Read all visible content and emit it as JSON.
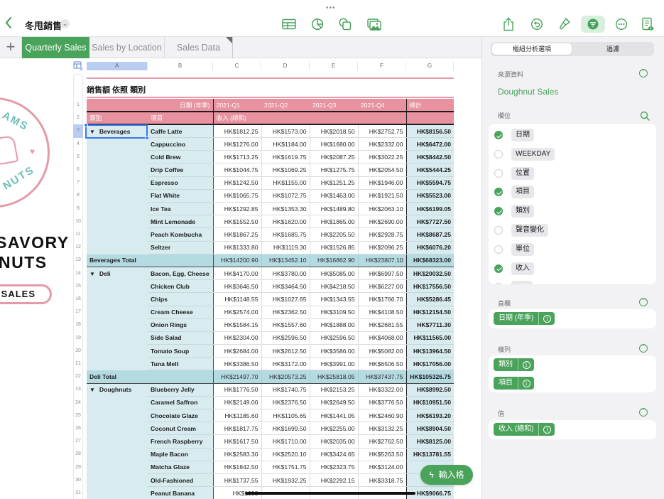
{
  "toolbar": {
    "grabber": "•••",
    "back_icon": "chevron-left-icon",
    "doc_title": "冬甩銷售",
    "title_menu_icon": "chevron-down-icon",
    "icons_center": [
      "table-icon",
      "chart-icon",
      "shapes-icon",
      "media-icon"
    ],
    "icons_right": [
      "share-icon",
      "undo-icon",
      "format-brush-icon",
      "organize-icon",
      "more-icon",
      "reading-view-icon"
    ],
    "accent_color": "#49a35a"
  },
  "sheet_tabs": {
    "add_label": "+",
    "tabs": [
      {
        "label": "Quarterly Sales",
        "active": true
      },
      {
        "label": "Sales by Location",
        "active": false
      },
      {
        "label": "Sales Data",
        "active": false
      }
    ]
  },
  "canvas": {
    "logo_top_text": "AMS",
    "logo_bottom_text": "NUTS",
    "headline_line1": "SAVORY",
    "headline_line2": "NUTS",
    "button_label": "T SALES"
  },
  "spreadsheet": {
    "column_letters": [
      "A",
      "B",
      "C",
      "D",
      "E",
      "F",
      "G"
    ],
    "selected_column": "A",
    "selected_row": 3,
    "row_numbers": [
      1,
      2,
      3,
      4,
      5,
      6,
      7,
      8,
      9,
      10,
      11,
      12,
      13,
      14,
      15,
      16,
      17,
      18,
      19,
      20,
      21,
      22,
      23,
      24,
      25,
      26,
      27,
      28,
      29,
      30,
      31
    ],
    "table_title": "銷售額 依照 類別",
    "header_row1": {
      "column_field": "日期 (年季)",
      "quarters": [
        "2021-Q1",
        "2021-Q2",
        "2021-Q3",
        "2021-Q4"
      ],
      "total_label": "總計"
    },
    "header_row2": {
      "category_label": "類別",
      "item_label": "項目",
      "value_label": "收入 (總和)"
    },
    "groups": [
      {
        "category": "Beverages",
        "rows": [
          {
            "item": "Caffe Latte",
            "q": [
              "HK$1812.25",
              "HK$1573.00",
              "HK$2018.50",
              "HK$2752.75"
            ],
            "total": "HK$8156.50"
          },
          {
            "item": "Cappuccino",
            "q": [
              "HK$1276.00",
              "HK$1184.00",
              "HK$1680.00",
              "HK$2332.00"
            ],
            "total": "HK$6472.00"
          },
          {
            "item": "Cold Brew",
            "q": [
              "HK$1713.25",
              "HK$1619.75",
              "HK$2087.25",
              "HK$3022.25"
            ],
            "total": "HK$8442.50"
          },
          {
            "item": "Drip Coffee",
            "q": [
              "HK$1044.75",
              "HK$1069.25",
              "HK$1275.75",
              "HK$2054.50"
            ],
            "total": "HK$5444.25"
          },
          {
            "item": "Espresso",
            "q": [
              "HK$1242.50",
              "HK$1155.00",
              "HK$1251.25",
              "HK$1946.00"
            ],
            "total": "HK$5594.75"
          },
          {
            "item": "Flat White",
            "q": [
              "HK$1065.75",
              "HK$1072.75",
              "HK$1463.00",
              "HK$1921.50"
            ],
            "total": "HK$5523.00"
          },
          {
            "item": "Ice Tea",
            "q": [
              "HK$1292.85",
              "HK$1353.30",
              "HK$1489.80",
              "HK$2063.10"
            ],
            "total": "HK$6199.05"
          },
          {
            "item": "Mint Lemonade",
            "q": [
              "HK$1552.50",
              "HK$1620.00",
              "HK$1865.00",
              "HK$2690.00"
            ],
            "total": "HK$7727.50"
          },
          {
            "item": "Peach Kombucha",
            "q": [
              "HK$1867.25",
              "HK$1685.75",
              "HK$2205.50",
              "HK$2928.75"
            ],
            "total": "HK$8687.25"
          },
          {
            "item": "Seltzer",
            "q": [
              "HK$1333.80",
              "HK$1119.30",
              "HK$1526.85",
              "HK$2096.25"
            ],
            "total": "HK$6076.20"
          }
        ],
        "subtotal": {
          "label": "Beverages Total",
          "q": [
            "HK$14200.90",
            "HK$13452.10",
            "HK$16862.90",
            "HK$23807.10"
          ],
          "total": "HK$68323.00"
        }
      },
      {
        "category": "Deli",
        "rows": [
          {
            "item": "Bacon, Egg, Cheese",
            "q": [
              "HK$4170.00",
              "HK$3780.00",
              "HK$5085.00",
              "HK$6997.50"
            ],
            "total": "HK$20032.50"
          },
          {
            "item": "Chicken Club",
            "q": [
              "HK$3646.50",
              "HK$3464.50",
              "HK$4218.50",
              "HK$6227.00"
            ],
            "total": "HK$17556.50"
          },
          {
            "item": "Chips",
            "q": [
              "HK$1148.55",
              "HK$1027.65",
              "HK$1343.55",
              "HK$1766.70"
            ],
            "total": "HK$5286.45"
          },
          {
            "item": "Cream Cheese",
            "q": [
              "HK$2574.00",
              "HK$2362.50",
              "HK$3109.50",
              "HK$4108.50"
            ],
            "total": "HK$12154.50"
          },
          {
            "item": "Onion Rings",
            "q": [
              "HK$1584.15",
              "HK$1557.60",
              "HK$1888.00",
              "HK$2681.55"
            ],
            "total": "HK$7711.30"
          },
          {
            "item": "Side Salad",
            "q": [
              "HK$2304.00",
              "HK$2596.50",
              "HK$2596.50",
              "HK$4068.00"
            ],
            "total": "HK$11565.00"
          },
          {
            "item": "Tomato Soup",
            "q": [
              "HK$2684.00",
              "HK$2612.50",
              "HK$3586.00",
              "HK$5082.00"
            ],
            "total": "HK$13964.50"
          },
          {
            "item": "Tuna Melt",
            "q": [
              "HK$3386.50",
              "HK$3172.00",
              "HK$3991.00",
              "HK$6506.50"
            ],
            "total": "HK$17056.00"
          }
        ],
        "subtotal": {
          "label": "Deli Total",
          "q": [
            "HK$21497.70",
            "HK$20573.25",
            "HK$25818.05",
            "HK$37437.75"
          ],
          "total": "HK$105326.75"
        }
      },
      {
        "category": "Doughnuts",
        "rows": [
          {
            "item": "Blueberry Jelly",
            "q": [
              "HK$1776.50",
              "HK$1740.75",
              "HK$2153.25",
              "HK$3322.00"
            ],
            "total": "HK$8992.50"
          },
          {
            "item": "Caramel Saffron",
            "q": [
              "HK$2149.00",
              "HK$2376.50",
              "HK$2649.50",
              "HK$3776.50"
            ],
            "total": "HK$10951.50"
          },
          {
            "item": "Chocolate Glaze",
            "q": [
              "HK$1185.60",
              "HK$1105.65",
              "HK$1441.05",
              "HK$2460.90"
            ],
            "total": "HK$6193.20"
          },
          {
            "item": "Coconut Cream",
            "q": [
              "HK$1817.75",
              "HK$1699.50",
              "HK$2255.00",
              "HK$3132.25"
            ],
            "total": "HK$8904.50"
          },
          {
            "item": "French Raspberry",
            "q": [
              "HK$1617.50",
              "HK$1710.00",
              "HK$2035.00",
              "HK$2762.50"
            ],
            "total": "HK$8125.00"
          },
          {
            "item": "Maple Bacon",
            "q": [
              "HK$2583.30",
              "HK$2520.10",
              "HK$3424.65",
              "HK$5263.50"
            ],
            "total": "HK$13781.55"
          },
          {
            "item": "Matcha Glaze",
            "q": [
              "HK$1842.50",
              "HK$1751.75",
              "HK$2323.75",
              "HK$3124.00"
            ],
            "total": "HK"
          },
          {
            "item": "Old-Fashioned",
            "q": [
              "HK$1737.55",
              "HK$1932.25",
              "HK$2292.15",
              "HK$3318.75"
            ],
            "total": "HK"
          },
          {
            "item": "Peanut Banana",
            "q": [
              "HK$1998",
              "",
              "",
              ""
            ],
            "total": "HK$9066.75"
          }
        ]
      }
    ]
  },
  "fab": {
    "label": "輸入格",
    "icon": "bolt-icon"
  },
  "panel": {
    "segments": [
      {
        "label": "樞紐分析選項",
        "active": true
      },
      {
        "label": "過濾",
        "active": false
      }
    ],
    "source_label": "來源資料",
    "source_value": "Doughnut Sales",
    "fields_label": "欄位",
    "fields": [
      {
        "label": "日期",
        "checked": true
      },
      {
        "label": "WEEKDAY",
        "checked": false
      },
      {
        "label": "位置",
        "checked": false
      },
      {
        "label": "項目",
        "checked": true
      },
      {
        "label": "類別",
        "checked": true
      },
      {
        "label": "聲音變化",
        "checked": false
      },
      {
        "label": "單位",
        "checked": false
      },
      {
        "label": "收入",
        "checked": true
      }
    ],
    "columns_label": "直欄",
    "columns": [
      "日期 (年季)"
    ],
    "rows_label": "橫列",
    "rows": [
      "類別",
      "項目"
    ],
    "values_label": "值",
    "values": [
      "收入 (總和)"
    ],
    "info_glyph": "i"
  }
}
